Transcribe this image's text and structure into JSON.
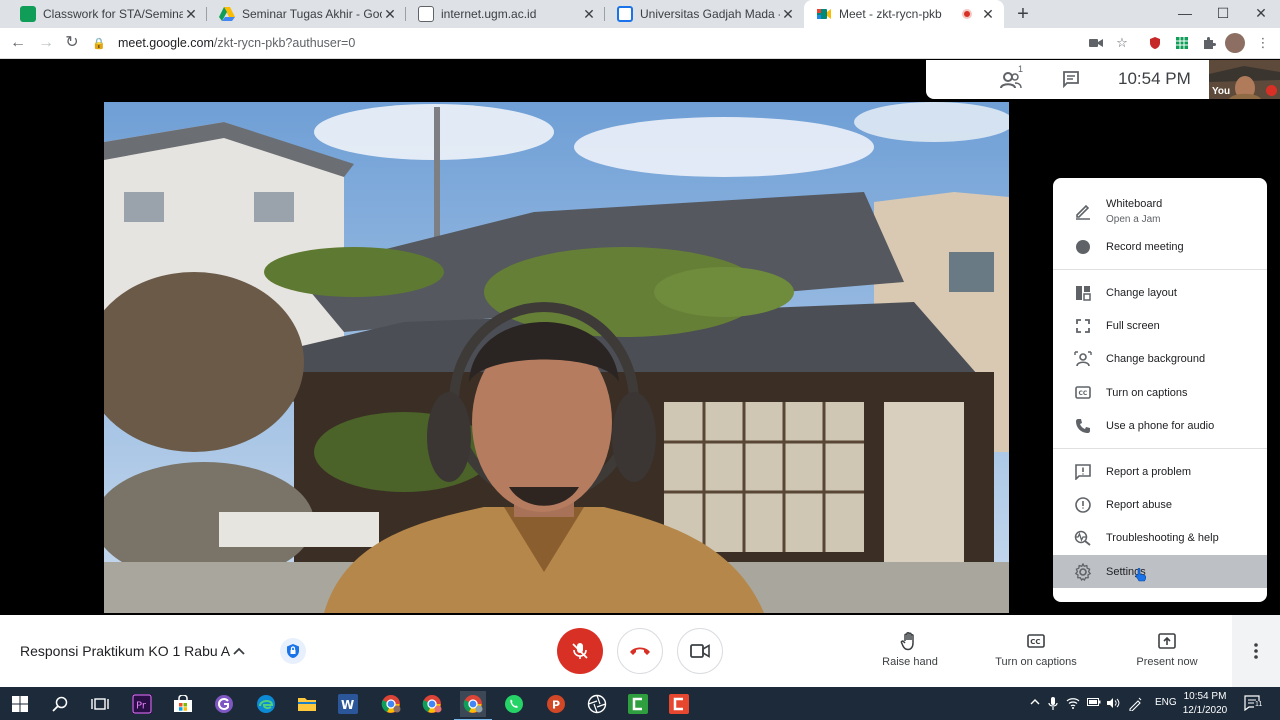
{
  "browser": {
    "tabs": [
      {
        "title": "Classwork for STA/Seminar Skripsi",
        "favicon_color": "#0f9d58"
      },
      {
        "title": "Seminar Tugas Akhir - Google Drive",
        "favicon_color": "#fbbc04"
      },
      {
        "title": "internet.ugm.ac.id",
        "favicon_color": "#5f6368"
      },
      {
        "title": "Universitas Gadjah Mada - Calendar",
        "favicon_color": "#1a73e8"
      },
      {
        "title": "Meet - zkt-rycn-pkb",
        "favicon_color": "#00897b",
        "active": true,
        "recording": true
      }
    ],
    "new_tab": "+",
    "url_host": "meet.google.com",
    "url_path": "/zkt-rycn-pkb?authuser=0"
  },
  "meet": {
    "participant_count": "1",
    "time": "10:54 PM",
    "self_label": "You",
    "meeting_title": "Responsi Praktikum KO 1 Rabu A",
    "controls": {
      "raise_hand": "Raise hand",
      "captions": "Turn on captions",
      "present": "Present now"
    }
  },
  "menu": {
    "whiteboard": {
      "label": "Whiteboard",
      "sub": "Open a Jam"
    },
    "record": "Record meeting",
    "change_layout": "Change layout",
    "full_screen": "Full screen",
    "change_background": "Change background",
    "captions": "Turn on captions",
    "phone_audio": "Use a phone for audio",
    "report_problem": "Report a problem",
    "report_abuse": "Report abuse",
    "troubleshooting": "Troubleshooting & help",
    "settings": "Settings"
  },
  "taskbar": {
    "language": "ENG",
    "time": "10:54 PM",
    "date": "12/1/2020",
    "notification_count": "11"
  },
  "colors": {
    "accent_red": "#d93025",
    "menu_highlight": "#bdc1c6",
    "taskbar": "#1c2a3a"
  }
}
